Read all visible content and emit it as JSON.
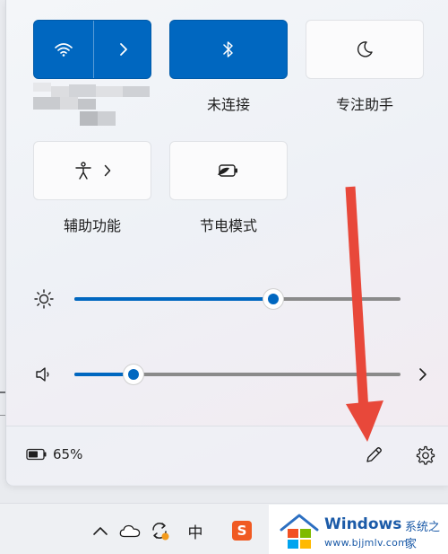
{
  "quick_settings": {
    "tiles": [
      {
        "id": "wifi",
        "label": "",
        "state": "on"
      },
      {
        "id": "bluetooth",
        "label": "未连接",
        "state": "on"
      },
      {
        "id": "focus",
        "label": "专注助手",
        "state": "off"
      },
      {
        "id": "accessibility",
        "label": "辅助功能",
        "state": "off"
      },
      {
        "id": "battery-saver",
        "label": "节电模式",
        "state": "off"
      }
    ],
    "brightness": {
      "level": 0.61
    },
    "volume": {
      "level": 0.18
    }
  },
  "footer": {
    "battery_percent": "65%"
  },
  "taskbar": {
    "ime_label": "中",
    "sogou_label": "S"
  },
  "watermark": {
    "brand": "Windows",
    "suffix": "系统之家",
    "url": "www.bjjmlv.com"
  },
  "colors": {
    "accent": "#0067c0",
    "annotation_arrow": "#e8483a"
  }
}
